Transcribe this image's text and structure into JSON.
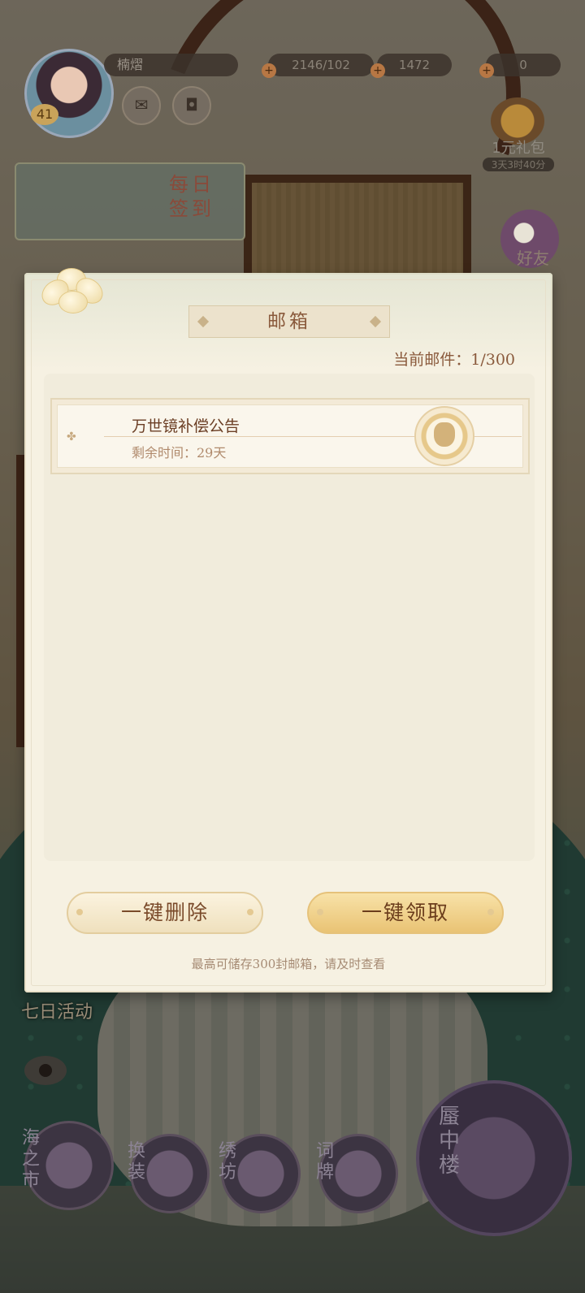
{
  "hud": {
    "player_name": "楠熠",
    "level": "41",
    "resources": [
      {
        "name": "stamina",
        "value": "2146/102"
      },
      {
        "name": "gold",
        "value": "1472"
      },
      {
        "name": "gem",
        "value": "0"
      }
    ],
    "gift": {
      "label": "1元礼包",
      "timer": "3天3时40分"
    },
    "daily_signin": "每日签到",
    "friends": "好友",
    "seven_day": "七日活动",
    "dock": [
      "海之市",
      "换装",
      "绣坊",
      "词牌"
    ],
    "tower": "蜃中楼"
  },
  "mailbox": {
    "title": "邮箱",
    "count_label": "当前邮件：",
    "count_value": "1/300",
    "mails": [
      {
        "subject": "万世镜补偿公告",
        "remaining": "剩余时间：29天"
      }
    ],
    "delete_all": "一键删除",
    "claim_all": "一键领取",
    "footer": "最高可储存300封邮箱，请及时查看"
  },
  "colors": {
    "modal_bg": "#f6f1e2",
    "title_text": "#8a5a3c",
    "claim_button": "#e9c374"
  }
}
